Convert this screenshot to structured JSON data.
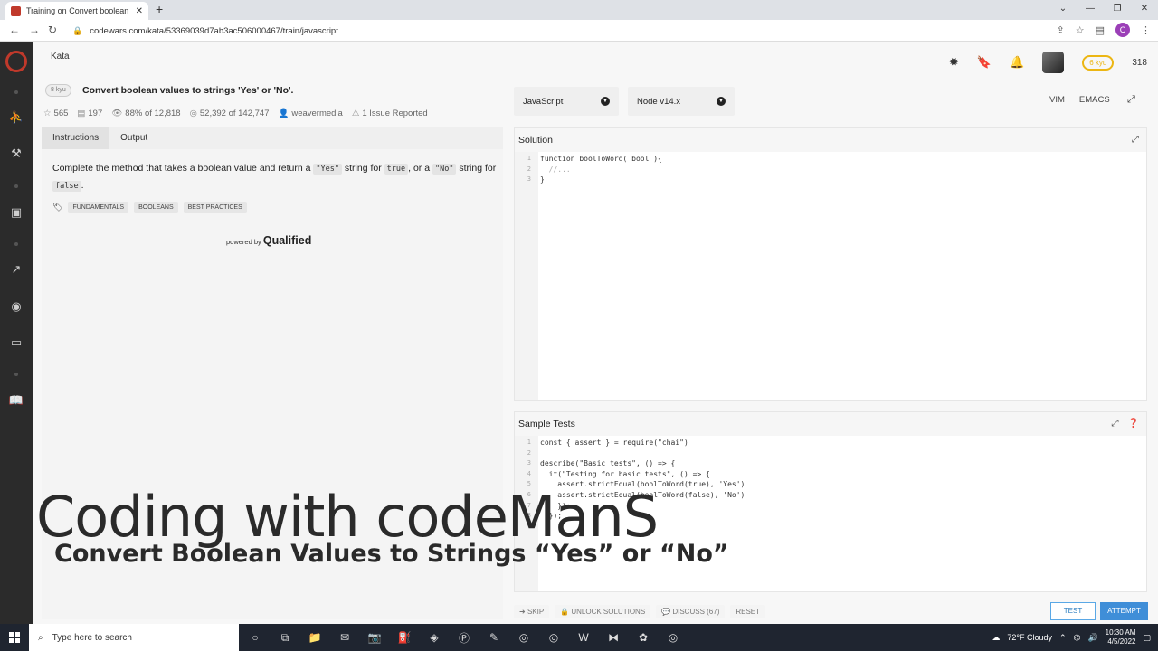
{
  "browser": {
    "tab_title": "Training on Convert boolean valu",
    "url": "codewars.com/kata/53369039d7ab3ac506000467/train/javascript"
  },
  "header": {
    "kata_tab": "Kata",
    "honor": "318",
    "rank": "6 kyu"
  },
  "kata": {
    "kyu": "8 kyu",
    "title": "Convert boolean values to strings 'Yes' or 'No'.",
    "stats": {
      "stars": "565",
      "votes": "197",
      "satisfaction": "88%",
      "satisfaction_of": "of 12,818",
      "completed": "52,392",
      "completed_of": "of 142,747",
      "author": "weavermedia",
      "issues": "1 Issue Reported"
    }
  },
  "instructions": {
    "tabs": [
      "Instructions",
      "Output"
    ],
    "desc": {
      "p1": "Complete the method that takes a boolean value and return a ",
      "c1": "\"Yes\"",
      "p2": " string for ",
      "c2": "true",
      "p3": ", or a ",
      "c3": "\"No\"",
      "p4": " string for ",
      "c4": "false",
      "p5": "."
    },
    "tags": [
      "FUNDAMENTALS",
      "BOOLEANS",
      "BEST PRACTICES"
    ],
    "powered_by": "powered by",
    "powered_brand": "Qualified"
  },
  "editor": {
    "language": "JavaScript",
    "node": "Node v14.x",
    "modes": [
      "VIM",
      "EMACS"
    ],
    "solution_title": "Solution",
    "solution_lines": [
      {
        "n": "1",
        "code": "function boolToWord( bool ){"
      },
      {
        "n": "2",
        "code": "  //..."
      },
      {
        "n": "3",
        "code": "}"
      }
    ],
    "tests_title": "Sample Tests",
    "test_lines": [
      {
        "n": "1",
        "code": "const { assert } = require(\"chai\")"
      },
      {
        "n": "2",
        "code": ""
      },
      {
        "n": "3",
        "code": "describe(\"Basic tests\", () => {"
      },
      {
        "n": "4",
        "code": "  it(\"Testing for basic tests\", () => {"
      },
      {
        "n": "5",
        "code": "    assert.strictEqual(boolToWord(true), 'Yes')"
      },
      {
        "n": "6",
        "code": "    assert.strictEqual(boolToWord(false), 'No')"
      },
      {
        "n": "7",
        "code": "    });"
      },
      {
        "n": "8",
        "code": "  });"
      }
    ]
  },
  "actions": {
    "skip": "SKIP",
    "unlock": "UNLOCK SOLUTIONS",
    "discuss": "DISCUSS (67)",
    "reset": "RESET",
    "test": "TEST",
    "attempt": "ATTEMPT"
  },
  "overlay": {
    "title": "Coding with codeManS",
    "subtitle": "Convert Boolean Values to Strings “Yes” or “No”"
  },
  "taskbar": {
    "search_placeholder": "Type here to search",
    "weather": "72°F  Cloudy",
    "time": "10:30 AM",
    "date": "4/5/2022"
  },
  "colors": {
    "sidebar": "#2b2b2b",
    "accent_red": "#c0392b",
    "attempt_blue": "#3f8ed8",
    "rank_yellow": "#ecb613"
  }
}
